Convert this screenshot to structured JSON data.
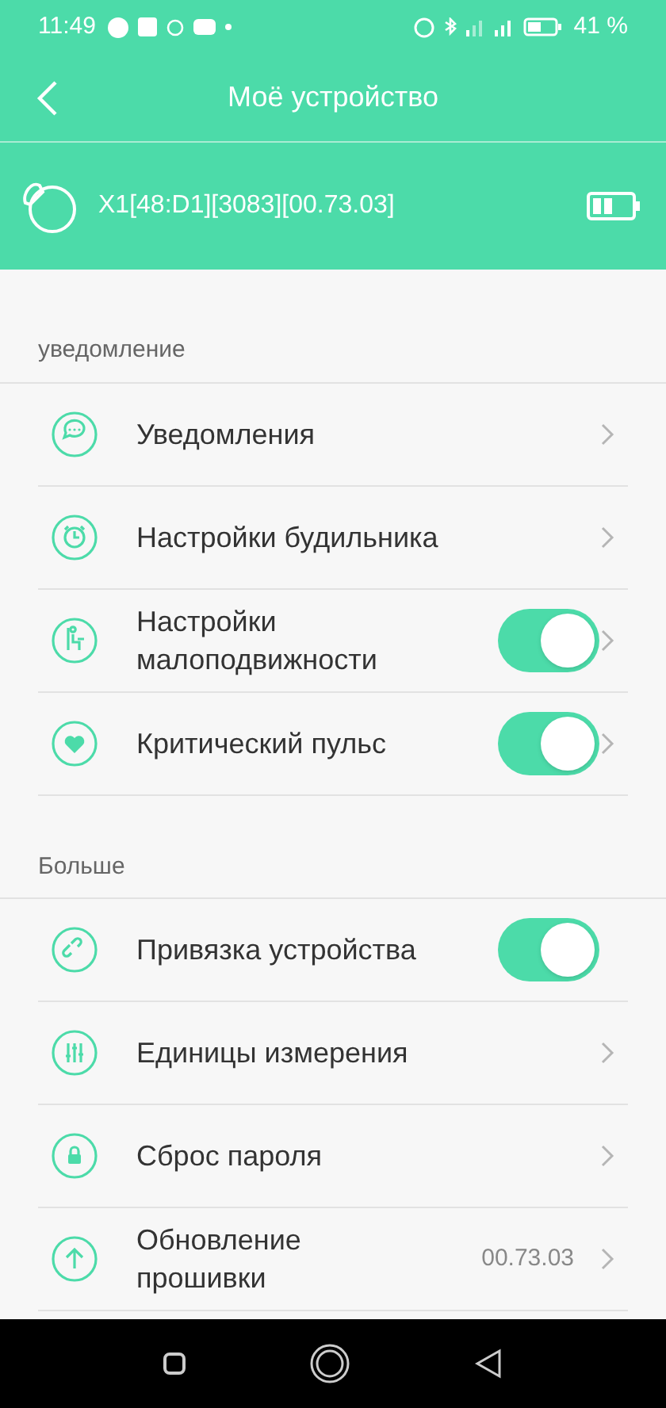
{
  "status_bar": {
    "time": "11:49",
    "battery": "41 %"
  },
  "header": {
    "title": "Моё устройство"
  },
  "device": {
    "name": "X1[48:D1][3083][00.73.03]"
  },
  "sections": [
    {
      "title": "уведомление",
      "items": [
        {
          "kind": "link",
          "label": "Уведомления"
        },
        {
          "kind": "link",
          "label": "Настройки будильника"
        },
        {
          "kind": "toggle",
          "label": "Настройки малоподвижности",
          "on": true,
          "chevron": true
        },
        {
          "kind": "toggle",
          "label": "Критический пульс",
          "on": true,
          "chevron": true
        }
      ]
    },
    {
      "title": "Больше",
      "items": [
        {
          "kind": "toggle",
          "label": "Привязка устройства",
          "on": true,
          "chevron": false
        },
        {
          "kind": "link",
          "label": "Единицы измерения"
        },
        {
          "kind": "link",
          "label": "Сброс пароля"
        },
        {
          "kind": "link",
          "label": "Обновление прошивки",
          "value": "00.73.03"
        }
      ]
    }
  ]
}
